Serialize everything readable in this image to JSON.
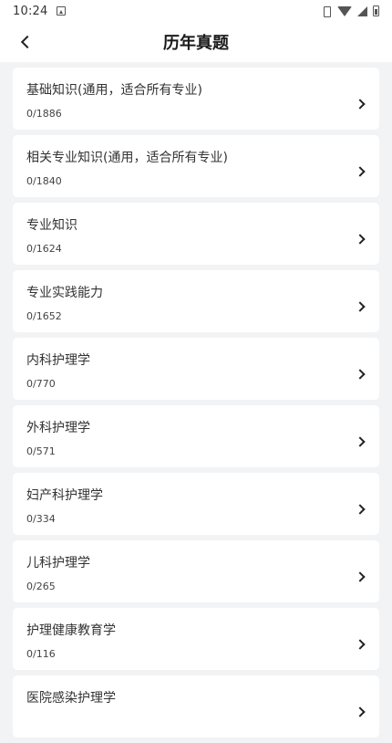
{
  "status_bar": {
    "time": "10:24"
  },
  "header": {
    "title": "历年真题"
  },
  "items": [
    {
      "title": "基础知识(通用，适合所有专业)",
      "count": "0/1886"
    },
    {
      "title": "相关专业知识(通用，适合所有专业)",
      "count": "0/1840"
    },
    {
      "title": "专业知识",
      "count": "0/1624"
    },
    {
      "title": "专业实践能力",
      "count": "0/1652"
    },
    {
      "title": "内科护理学",
      "count": "0/770"
    },
    {
      "title": "外科护理学",
      "count": "0/571"
    },
    {
      "title": "妇产科护理学",
      "count": "0/334"
    },
    {
      "title": "儿科护理学",
      "count": "0/265"
    },
    {
      "title": "护理健康教育学",
      "count": "0/116"
    },
    {
      "title": "医院感染护理学",
      "count": ""
    }
  ],
  "icons": {
    "back": "chevron-left-icon",
    "row_arrow": "chevron-right-icon"
  }
}
